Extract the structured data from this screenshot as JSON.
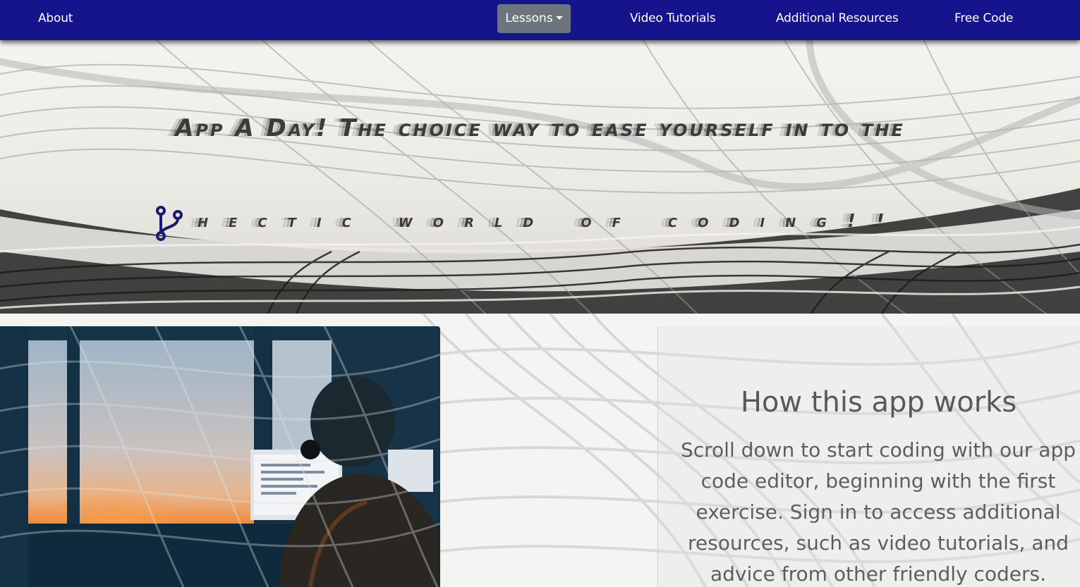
{
  "nav": {
    "about": "About",
    "lessons": "Lessons",
    "video_tutorials": "Video Tutorials",
    "additional_resources": "Additional Resources",
    "free_code": "Free Code"
  },
  "hero": {
    "title": "App A Day! The choice way to ease yourself in to the",
    "subtitle": "hectic world of coding!!",
    "icon": "code-branch-icon"
  },
  "content": {
    "image": "person-at-computer-sunset-photo",
    "heading": "How this app works",
    "body": "Scroll down to start coding with our app code editor, beginning with the first exercise. Sign in to access additional resources, such as video tutorials, and advice from other friendly coders."
  },
  "colors": {
    "navbar": "#16148c",
    "dropdown": "#6c757d",
    "icon": "#1a1a6e",
    "heading_text": "#595959"
  }
}
